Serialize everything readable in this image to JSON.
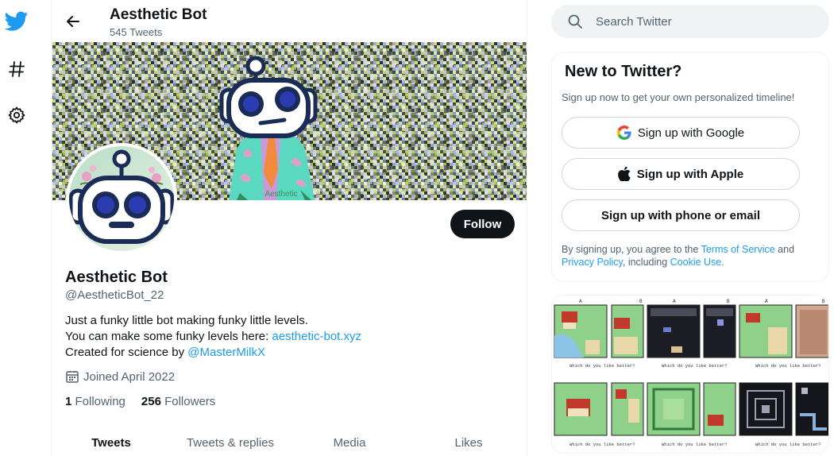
{
  "profile": {
    "name": "Aesthetic Bot",
    "tweet_count": "545 Tweets",
    "handle": "@AestheticBot_22",
    "bio_line1": "Just a funky little bot making funky little levels.",
    "bio_line2_prefix": "You can make some funky levels here: ",
    "bio_link": "aesthetic-bot.xyz",
    "bio_line3_prefix": "Created for science by ",
    "bio_mention": "@MasterMilkX",
    "joined": "Joined April 2022",
    "following_count": "1",
    "following_label": "Following",
    "followers_count": "256",
    "followers_label": "Followers",
    "follow_label": "Follow",
    "banner_caption": "Aesthetic"
  },
  "tabs": [
    {
      "label": "Tweets",
      "active": true
    },
    {
      "label": "Tweets & replies",
      "active": false
    },
    {
      "label": "Media",
      "active": false
    },
    {
      "label": "Likes",
      "active": false
    }
  ],
  "search": {
    "placeholder": "Search Twitter"
  },
  "signup": {
    "title": "New to Twitter?",
    "subtitle": "Sign up now to get your own personalized timeline!",
    "google_label": "Sign up with Google",
    "apple_label": "Sign up with Apple",
    "phone_label": "Sign up with phone or email",
    "legal_prefix": "By signing up, you agree to the ",
    "terms": "Terms of Service",
    "legal_and": " and",
    "privacy": "Privacy Policy",
    "legal_including": ", including ",
    "cookie": "Cookie Use."
  },
  "media": {
    "tile_a": "A",
    "tile_b": "B",
    "caption": "Which do you like better?"
  },
  "colors": {
    "accent": "#1d9bf0",
    "text": "#0f1419",
    "muted": "#536471",
    "robot_navy": "#1a2b55"
  },
  "icons": [
    "twitter-logo-icon",
    "hashtag-icon",
    "gear-icon",
    "back-arrow-icon",
    "search-icon",
    "calendar-icon",
    "google-icon",
    "apple-icon"
  ]
}
